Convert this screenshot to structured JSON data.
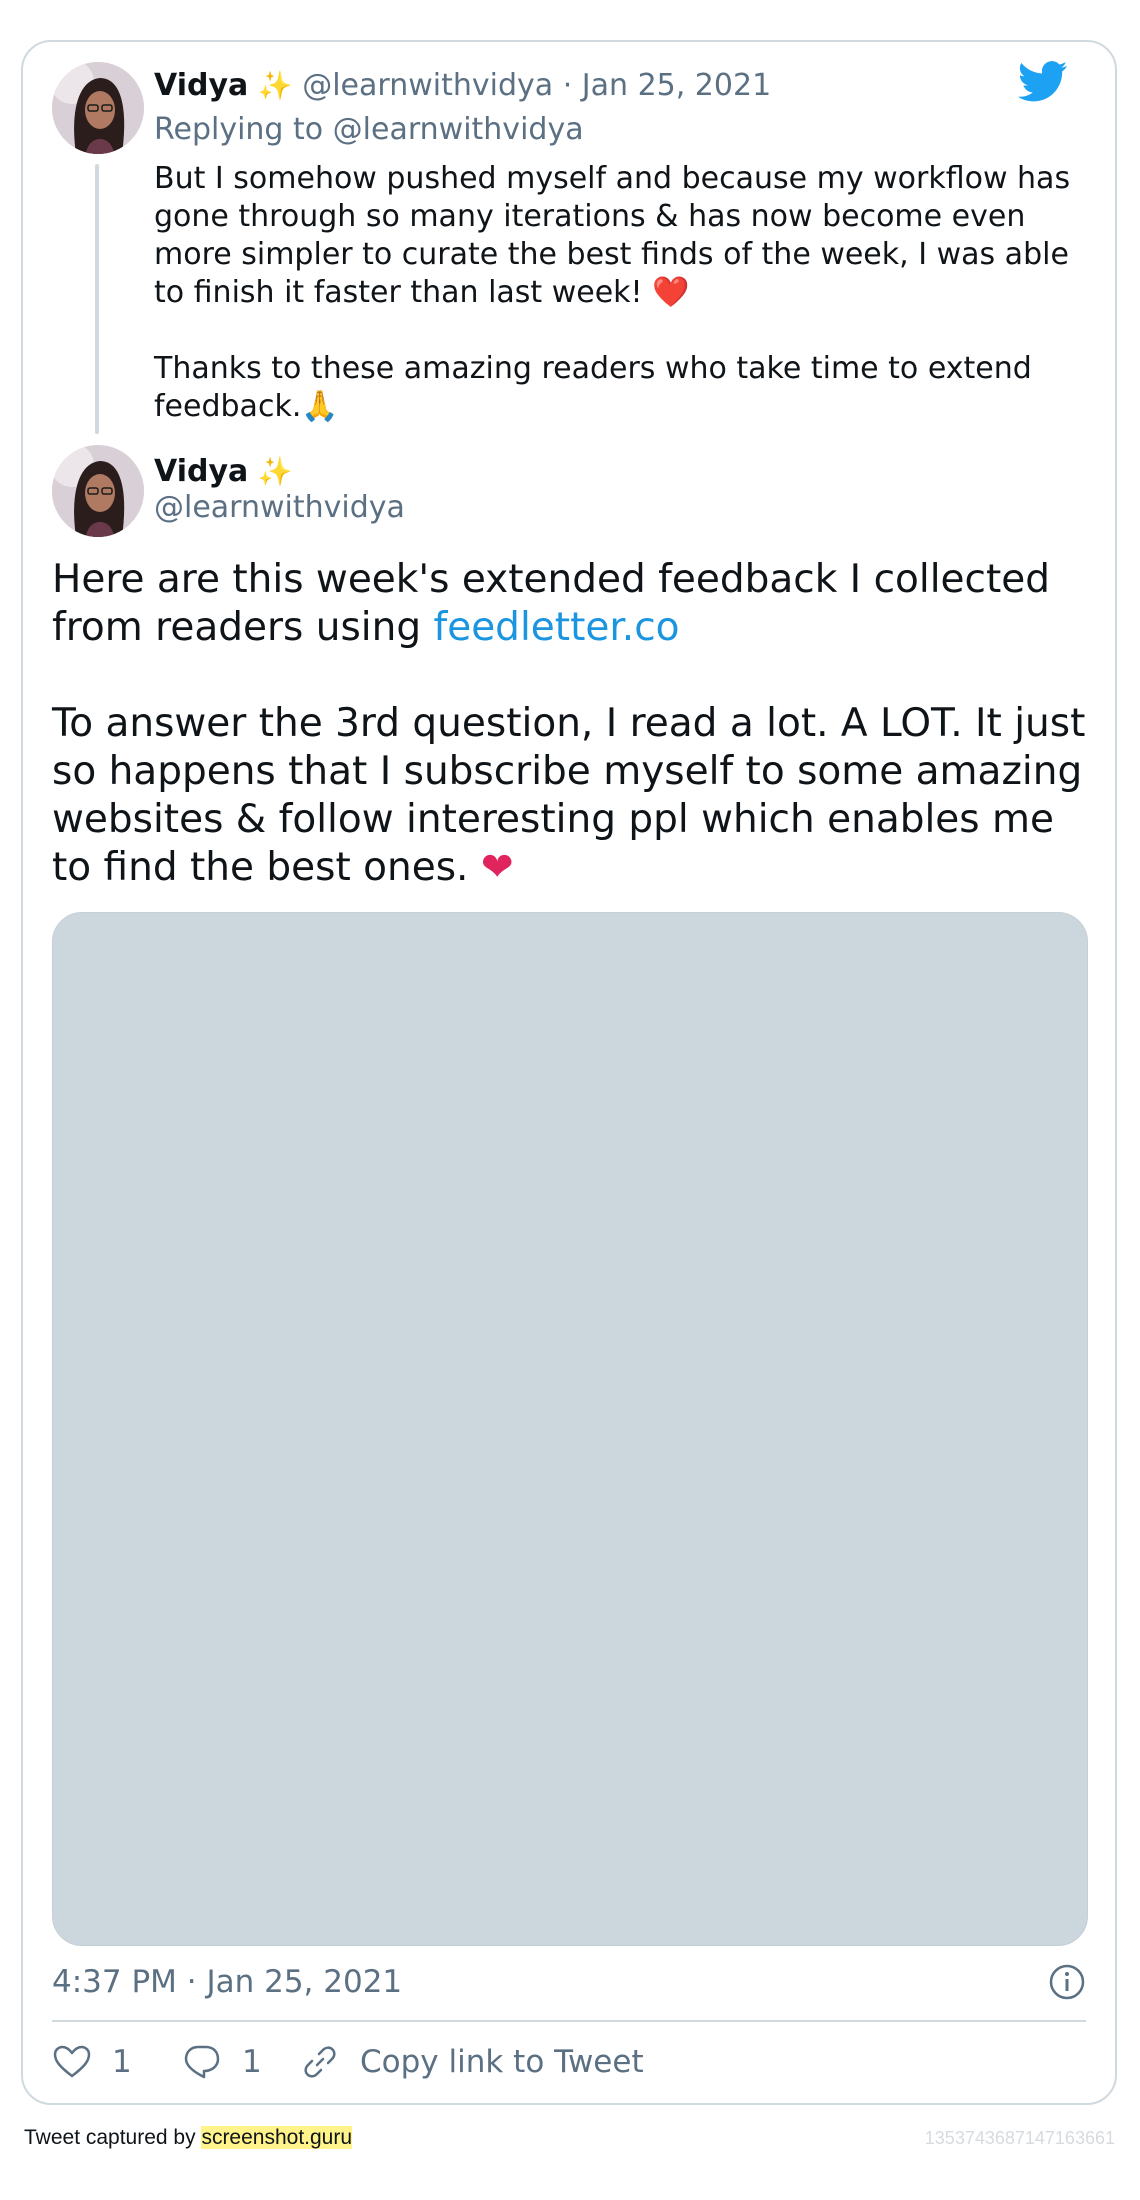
{
  "reply_tweet": {
    "author_name": "Vidya",
    "author_emoji": "✨",
    "handle": "@learnwithvidya",
    "separator": "·",
    "date": "Jan 25, 2021",
    "replying_to": "Replying to @learnwithvidya",
    "text": "But I somehow pushed myself and because my workflow has gone through so many iterations & has now become even more simpler to curate the best finds of the week, I was able to finish it faster than last week! ❤️\n\nThanks to these amazing readers who take time to extend feedback.🙏"
  },
  "main_tweet": {
    "author_name": "Vidya",
    "author_emoji": "✨",
    "handle": "@learnwithvidya",
    "text_part1": "Here are this week's extended feedback I collected from readers using ",
    "link_text": "feedletter.co",
    "text_part2": "To answer the 3rd question, I read a lot. A LOT. It just so happens that I subscribe myself to some amazing websites & follow interesting ppl which enables me to  find the best ones. ",
    "heart": "❤",
    "timestamp": "4:37 PM · Jan 25, 2021"
  },
  "actions": {
    "like_count": "1",
    "reply_count": "1",
    "copy_link_label": "Copy link to Tweet"
  },
  "footer": {
    "captured_by": "Tweet captured by ",
    "site": "screenshot.guru",
    "tweet_id": "1353743687147163661"
  },
  "colors": {
    "twitter_blue": "#1da1f2",
    "link": "#1b95e0",
    "muted": "#5b7083",
    "media_placeholder": "#ccd6dd",
    "heart": "#e0245e"
  }
}
